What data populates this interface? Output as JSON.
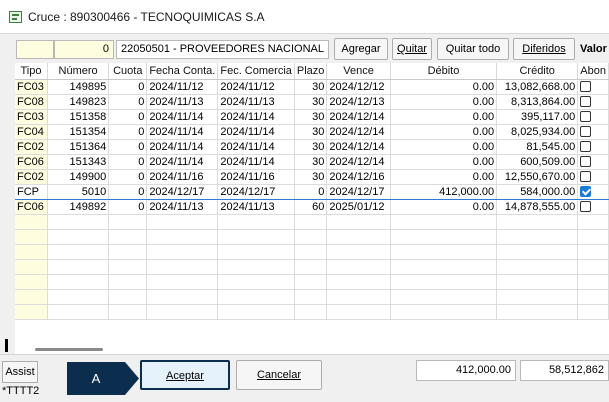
{
  "window": {
    "title": "Cruce : 890300466 - TECNOQUIMICAS S.A"
  },
  "toolbar": {
    "blank_value": "",
    "count_value": "0",
    "account": "22050501 - PROVEEDORES NACIONAL",
    "agregar_label": "Agregar",
    "quitar_label": "Quitar",
    "quitar_todo_label": "Quitar todo",
    "diferidos_label": "Diferidos",
    "valor_label": "Valor"
  },
  "grid": {
    "columns": [
      "Tipo",
      "Número",
      "Cuota",
      "Fecha Conta.",
      "Fec. Comercia",
      "Plazo",
      "Vence",
      "Débito",
      "Crédito",
      "Abon"
    ],
    "rows": [
      {
        "tipo": "FC03",
        "numero": "149895",
        "cuota": "0",
        "fecha_conta": "2024/11/12",
        "fec_comercial": "2024/11/12",
        "plazo": "30",
        "vence": "2024/12/12",
        "debito": "0.00",
        "credito": "13,082,668.00",
        "abono": false
      },
      {
        "tipo": "FC08",
        "numero": "149823",
        "cuota": "0",
        "fecha_conta": "2024/11/13",
        "fec_comercial": "2024/11/13",
        "plazo": "30",
        "vence": "2024/12/13",
        "debito": "0.00",
        "credito": "8,313,864.00",
        "abono": false
      },
      {
        "tipo": "FC03",
        "numero": "151358",
        "cuota": "0",
        "fecha_conta": "2024/11/14",
        "fec_comercial": "2024/11/14",
        "plazo": "30",
        "vence": "2024/12/14",
        "debito": "0.00",
        "credito": "395,117.00",
        "abono": false
      },
      {
        "tipo": "FC04",
        "numero": "151354",
        "cuota": "0",
        "fecha_conta": "2024/11/14",
        "fec_comercial": "2024/11/14",
        "plazo": "30",
        "vence": "2024/12/14",
        "debito": "0.00",
        "credito": "8,025,934.00",
        "abono": false
      },
      {
        "tipo": "FC02",
        "numero": "151364",
        "cuota": "0",
        "fecha_conta": "2024/11/14",
        "fec_comercial": "2024/11/14",
        "plazo": "30",
        "vence": "2024/12/14",
        "debito": "0.00",
        "credito": "81,545.00",
        "abono": false
      },
      {
        "tipo": "FC06",
        "numero": "151343",
        "cuota": "0",
        "fecha_conta": "2024/11/14",
        "fec_comercial": "2024/11/14",
        "plazo": "30",
        "vence": "2024/12/14",
        "debito": "0.00",
        "credito": "600,509.00",
        "abono": false
      },
      {
        "tipo": "FC02",
        "numero": "149900",
        "cuota": "0",
        "fecha_conta": "2024/11/16",
        "fec_comercial": "2024/11/16",
        "plazo": "30",
        "vence": "2024/12/16",
        "debito": "0.00",
        "credito": "12,550,670.00",
        "abono": false
      },
      {
        "tipo": "FCP",
        "numero": "5010",
        "cuota": "0",
        "fecha_conta": "2024/12/17",
        "fec_comercial": "2024/12/17",
        "plazo": "0",
        "vence": "2024/12/17",
        "debito": "412,000.00",
        "credito": "584,000.00",
        "abono": true
      },
      {
        "tipo": "FC06",
        "numero": "149892",
        "cuota": "0",
        "fecha_conta": "2024/11/13",
        "fec_comercial": "2024/11/13",
        "plazo": "60",
        "vence": "2025/01/12",
        "debito": "0.00",
        "credito": "14,878,555.00",
        "abono": false
      }
    ]
  },
  "footer": {
    "assist_label": "Assist",
    "user": "*TTTT2",
    "marker_label": "A",
    "aceptar_label": "Aceptar",
    "cancelar_label": "Cancelar",
    "total_debito": "412,000.00",
    "total_credito": "58,512,862"
  },
  "colors": {
    "selected_row_border": "#2e7bd6",
    "tipo_column_bg": "#fffde0",
    "marker_bg": "#0b2e4e",
    "checkbox_on": "#1a7ad8"
  },
  "icons": [
    "app-icon",
    "checkbox-icon",
    "arrow-marker-icon"
  ]
}
